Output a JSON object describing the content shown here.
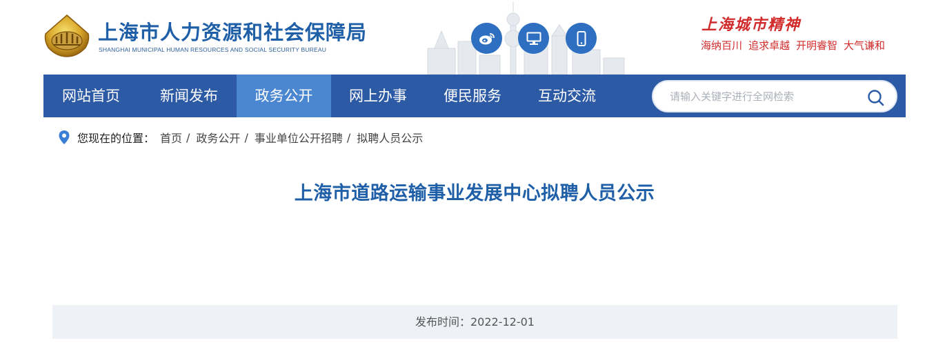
{
  "header": {
    "org_name_cn": "上海市人力资源和社会保障局",
    "org_name_en": "SHANGHAI MUNICIPAL HUMAN RESOURCES AND SOCIAL SECURITY BUREAU",
    "spirit_title": "上海城市精神",
    "spirit_words": [
      "海纳百川",
      "追求卓越",
      "开明睿智",
      "大气谦和"
    ],
    "icons": [
      "weibo-icon",
      "desktop-icon",
      "mobile-icon"
    ]
  },
  "nav": {
    "items": [
      "网站首页",
      "新闻发布",
      "政务公开",
      "网上办事",
      "便民服务",
      "互动交流"
    ],
    "active": "政务公开"
  },
  "search": {
    "placeholder": "请输入关键字进行全网检索"
  },
  "breadcrumb": {
    "label": "您现在的位置：",
    "items": [
      "首页",
      "政务公开",
      "事业单位公开招聘",
      "拟聘人员公示"
    ],
    "separator": "/"
  },
  "article": {
    "title": "上海市道路运输事业发展中心拟聘人员公示",
    "publish_label": "发布时间：2022-12-01"
  },
  "colors": {
    "nav_bg": "#2c5aa4",
    "nav_active": "#4b86d1",
    "title_blue": "#1e5fa8",
    "spirit_red": "#d22b2b"
  }
}
